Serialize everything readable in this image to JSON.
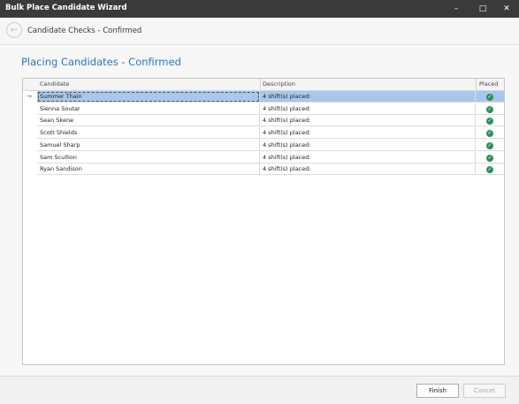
{
  "window": {
    "title": "Bulk Place Candidate Wizard",
    "minimize": "–",
    "maximize": "□",
    "close": "✕"
  },
  "header": {
    "back_icon": "←",
    "step_title": "Candidate Checks - Confirmed"
  },
  "page": {
    "title": "Placing Candidates - Confirmed"
  },
  "grid": {
    "columns": [
      "Candidate",
      "Description",
      "Placed"
    ],
    "rows": [
      {
        "candidate": "Summer Thain",
        "description": "4 shift(s) placed:",
        "placed": true
      },
      {
        "candidate": "Sienna Soutar",
        "description": "4 shift(s) placed:",
        "placed": true
      },
      {
        "candidate": "Sean Skene",
        "description": "4 shift(s) placed:",
        "placed": true
      },
      {
        "candidate": "Scott Shields",
        "description": "4 shift(s) placed:",
        "placed": true
      },
      {
        "candidate": "Samuel Sharp",
        "description": "4 shift(s) placed:",
        "placed": true
      },
      {
        "candidate": "Sam Scullion",
        "description": "4 shift(s) placed:",
        "placed": true
      },
      {
        "candidate": "Ryan Sandison",
        "description": "4 shift(s) placed:",
        "placed": true
      }
    ],
    "row_indicator": "→",
    "check_glyph": "✓",
    "check_color": "#2f8f5b"
  },
  "footer": {
    "finish_label": "Finish",
    "cancel_label": "Cancel"
  }
}
